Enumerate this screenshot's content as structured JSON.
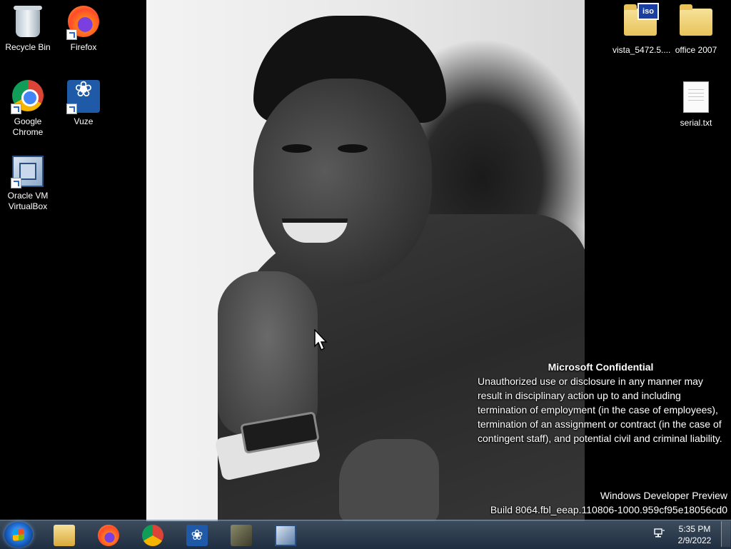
{
  "desktop": {
    "icons_left": [
      {
        "label": "Recycle Bin",
        "icon": "recycle-bin-icon"
      },
      {
        "label": "Firefox",
        "icon": "firefox-icon"
      },
      {
        "label": "Google Chrome",
        "icon": "chrome-icon"
      },
      {
        "label": "Vuze",
        "icon": "vuze-icon"
      },
      {
        "label": "Oracle VM VirtualBox",
        "icon": "virtualbox-icon"
      }
    ],
    "icons_right": [
      {
        "label": "vista_5472.5....",
        "icon": "iso-folder-icon",
        "badge": "iso"
      },
      {
        "label": "office 2007",
        "icon": "folder-icon"
      },
      {
        "label": "serial.txt",
        "icon": "text-file-icon"
      }
    ]
  },
  "watermark": {
    "title": "Microsoft Confidential",
    "body": "Unauthorized use or disclosure in any manner may result in disciplinary action up to and including termination of employment (in the case of employees), termination of an assignment or contract (in the case of contingent staff), and potential civil and criminal liability.",
    "edition": "Windows Developer Preview",
    "build": "Build 8064.fbl_eeap.110806-1000.959cf95e18056cd0"
  },
  "taskbar": {
    "pinned": [
      {
        "name": "File Explorer",
        "icon": "file-explorer-icon"
      },
      {
        "name": "Firefox",
        "icon": "firefox-icon"
      },
      {
        "name": "Google Chrome",
        "icon": "chrome-icon"
      },
      {
        "name": "Vuze",
        "icon": "vuze-icon"
      },
      {
        "name": "Tool",
        "icon": "tool-icon"
      },
      {
        "name": "Oracle VM VirtualBox",
        "icon": "virtualbox-icon"
      }
    ],
    "clock_time": "5:35 PM",
    "clock_date": "2/9/2022"
  },
  "colors": {
    "desktop_background": "#000000",
    "taskbar": "#3a5572",
    "text": "#ffffff"
  }
}
